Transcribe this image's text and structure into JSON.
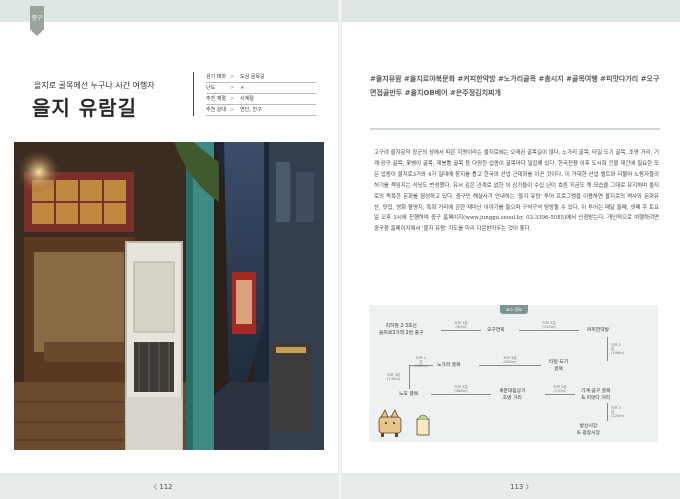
{
  "left_page": {
    "section_tab": "중구",
    "subtitle": "을지로 골목에선 누구나 시간 여행자",
    "title": "을지 유람길",
    "info": [
      {
        "key": "걷기 테마",
        "value": "도심 골목길"
      },
      {
        "key": "난도",
        "value": "★"
      },
      {
        "key": "추천 계절",
        "value": "사계절"
      },
      {
        "key": "추천 상대",
        "value": "연인, 친구"
      }
    ],
    "page_number": "112"
  },
  "right_page": {
    "hashtags": "#을지유람 #을지로야북문화 #커피한약방 #노가리골목 #충시지 #골목여행 #피맛다가리 #오구면접골만두 #을지OB베어 #은주정김치찌개",
    "body": "고구려 을지문덕 장군의 성에서 따온 지명이라는 을지로에는 오래된 골목길이 많다. 노가리 골목, 타일·도기 골목, 조명 거리, 기계·공구 골목, 꽃벵이 골목, 재봉틀 골목 등 다양한 업종이 골목마다 밀집해 있다. 한국전쟁 이후 도시화 건물 재건에 필요한 모든 업종이 을지로3가와 4가 일대에 둥지를 틀고 한국의 산업 근대화를 이끈 것이다. 이 거대한 산업 벨트와 더불어 노동자들의 허기를 책임지는 식당도 번성했다. 유서 깊은 관계로 없한 이 상가들이 수십 년이 흐른 지금도 옛 모습을 그대로 유지하며 을지로의 독특한 문화를 형성하고 있다. 중구민 해설사가 안내하는 '을지 유람' 투어 프로그램을 이용하면 을지로의 역사와 문화유산, 맛집, 영화 촬영지, 특화 거리에 관한 재미난 이야기를 들으며 구석구석 탐방할 수 있다. 이 투어는 매달 둘째, 넷째 주 토요일 오후 3시에 진행하며 중구 홈페이지(www.junggu.seoul.kr, 02-3396-5085)에서 신청받는다. 개인적으로 여행하려면 중구청 홈페이지에서 '을지 유람' 지도를 미리 다운받아두는 것이 좋다.",
    "route_header": "코스 정보",
    "route": {
      "start": "지하철 2·3호선\n을지로3가역 2번 출구",
      "n1": "오구면옥",
      "n2": "커피한약방",
      "n3": "타일·도기\n골목",
      "n4": "노가리 골목",
      "n5": "노포 골목",
      "n6": "세운대림상가\n조명 거리",
      "n7": "기계·공구 골목\n& 피맛다 거리",
      "n8": "방산시장\n& 광장시장",
      "e1": "도보 1분\n(30m)",
      "e2": "도보 2분\n(110m)",
      "e3": "도보 2분\n(106m)",
      "e4": "도보 3분\n(200m)",
      "e5": "도보 2분\n(140m)",
      "e6": "도보 3분\n(140m)",
      "e7": "도보 5분\n(288m)",
      "e8": "도보 2분\n(110m)",
      "e9": "도보 2분\n(125m)",
      "e10": "도보 6분\n(356m)"
    },
    "page_number": "113"
  },
  "colors": {
    "top_band": "#dfe6e6",
    "accent": "#7e9693",
    "title": "#2a2a2a"
  }
}
